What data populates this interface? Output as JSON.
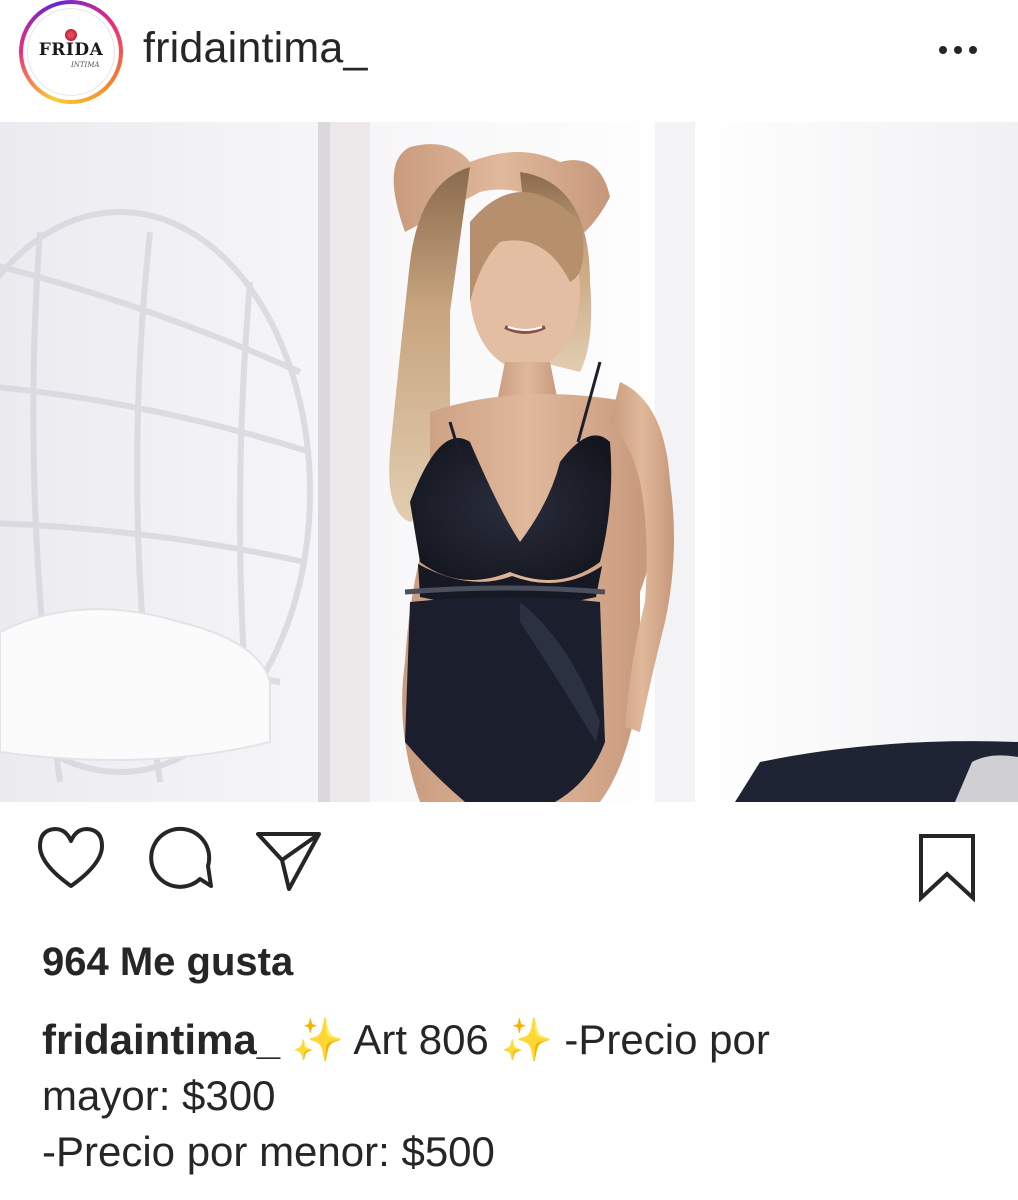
{
  "post": {
    "username": "fridaintima_",
    "avatar_brand": "FRIDA",
    "avatar_sub": "INTIMA",
    "likes_text": "964 Me gusta",
    "caption": {
      "username": "fridaintima_",
      "line1_rest": " ✨ Art 806 ✨ -Precio por",
      "line2": "mayor: $300",
      "line3": "-Precio por menor: $500"
    }
  },
  "icons": {
    "more": "more-options-icon",
    "like": "heart-icon",
    "comment": "comment-bubble-icon",
    "share": "paper-plane-icon",
    "save": "bookmark-icon"
  },
  "colors": {
    "text": "#262626",
    "story_ring_start": "#f9ce34",
    "story_ring_mid": "#ee2a7b",
    "story_ring_end": "#6228d7"
  }
}
